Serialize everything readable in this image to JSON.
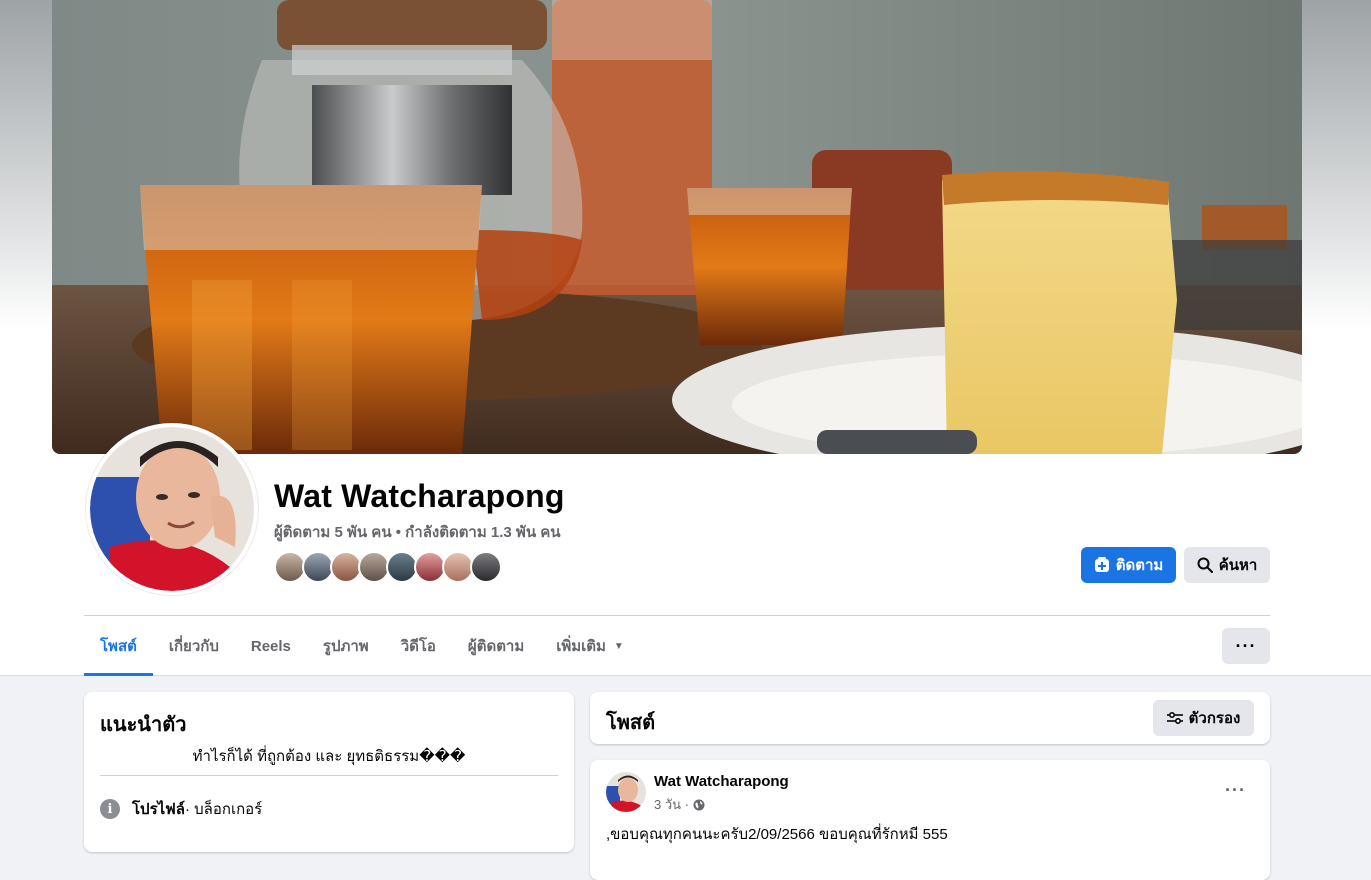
{
  "profile": {
    "name": "Wat Watcharapong",
    "stats": "ผู้ติดตาม 5 พัน คน • กำลังติดตาม 1.3 พัน คน"
  },
  "actions": {
    "follow_label": "ติดตาม",
    "search_label": "ค้นหา"
  },
  "tabs": [
    {
      "label": "โพสต์",
      "active": true
    },
    {
      "label": "เกี่ยวกับ"
    },
    {
      "label": "Reels"
    },
    {
      "label": "รูปภาพ"
    },
    {
      "label": "วิดีโอ"
    },
    {
      "label": "ผู้ติดตาม"
    },
    {
      "label": "เพิ่มเติม"
    }
  ],
  "intro": {
    "title": "แนะนำตัว",
    "bio": "ทำไรก็ได้ ที่ถูกต้อง และ ยุทธติธรรม���",
    "category_label": "โปรไฟล์",
    "category_value": " · บล็อกเกอร์"
  },
  "posts": {
    "title": "โพสต์",
    "filter_label": "ตัวกรอง"
  },
  "post": {
    "author": "Wat Watcharapong",
    "time": "3 วัน ·",
    "text": ",ขอบคุณทุกคนนะครับ2/09/2566 ขอบคุณที่รักหมี 555"
  },
  "colors": {
    "accent": "#1b74e4",
    "page_bg": "#f0f2f5",
    "secondary_button": "#e4e6eb"
  },
  "icons": {
    "follow": "follow-plus-icon",
    "search": "search-icon",
    "more": "more-dots-icon",
    "filter": "filter-sliders-icon",
    "info": "info-icon",
    "globe": "globe-icon"
  }
}
